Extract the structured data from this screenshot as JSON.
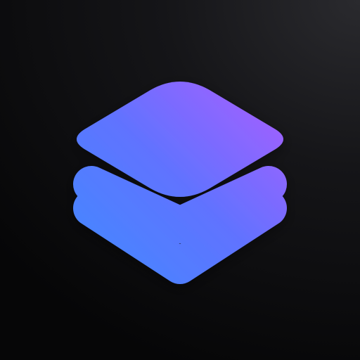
{
  "icon": {
    "name": "stacked-layers-icon",
    "background": {
      "dark": "#060607",
      "mid": "#151518",
      "light": "#2a2a2e"
    },
    "gradient": {
      "start": "#3f8cff",
      "middle": "#5f73ff",
      "end": "#b05cff"
    }
  }
}
